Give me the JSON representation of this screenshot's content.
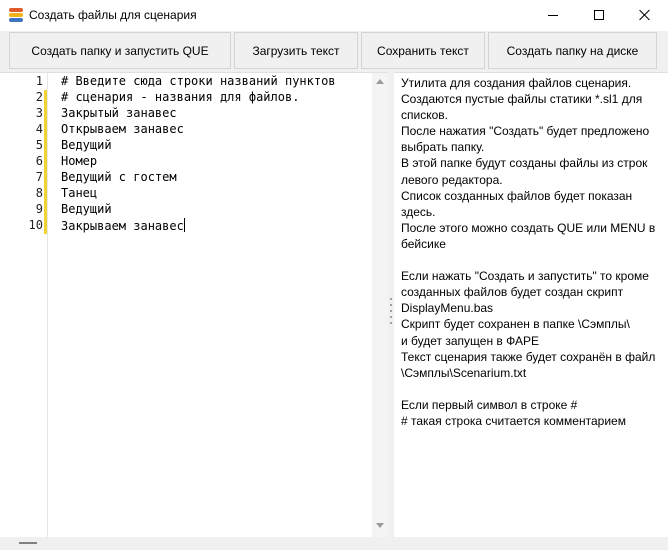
{
  "window": {
    "title": "Создать файлы для сценария",
    "app_icon": "stack-icon",
    "controls": [
      "minimize-icon",
      "maximize-icon",
      "close-icon"
    ]
  },
  "toolbar": {
    "create_folder_run_que": "Создать папку и запустить QUE",
    "load_text": "Загрузить текст",
    "save_text": "Сохранить текст",
    "create_folder_on_disk": "Создать папку на диске"
  },
  "editor": {
    "lines": [
      {
        "num": "1",
        "text": "# Введите сюда строки названий пунктов",
        "changed": false
      },
      {
        "num": "2",
        "text": "# сценария - названия для файлов.",
        "changed": true
      },
      {
        "num": "3",
        "text": "Закрытый занавес",
        "changed": true
      },
      {
        "num": "4",
        "text": "Открываем занавес",
        "changed": true
      },
      {
        "num": "5",
        "text": "Ведущий",
        "changed": true
      },
      {
        "num": "6",
        "text": "Номер",
        "changed": true
      },
      {
        "num": "7",
        "text": "Ведущий с гостем",
        "changed": true
      },
      {
        "num": "8",
        "text": "Танец",
        "changed": true
      },
      {
        "num": "9",
        "text": "Ведущий",
        "changed": true
      },
      {
        "num": "10",
        "text": "Закрываем занавес",
        "changed": true
      }
    ],
    "change_color": "#f2d233"
  },
  "info_panel": {
    "lines": [
      "Утилита для создания файлов сценария.",
      "Создаются пустые файлы статики *.sl1 для",
      "списков.",
      "После нажатия \"Создать\" будет предложено",
      "выбрать папку.",
      "В этой папке будут созданы файлы из строк",
      "левого редактора.",
      "Список созданных файлов будет показан",
      "здесь.",
      "После этого можно создать QUE или MENU в",
      "бейсике",
      "",
      "Если нажать \"Создать и запустить\" то кроме",
      "созданных файлов будет создан скрипт",
      "DisplayMenu.bas",
      "Скрипт будет сохранен в папке \\Сэмплы\\",
      "и будет запущен в ФАРЕ",
      "Текст сценария также будет сохранён в файл",
      "\\Сэмплы\\Scenarium.txt",
      "",
      "Если первый символ в строке #",
      "#  такая строка считается комментарием"
    ]
  }
}
